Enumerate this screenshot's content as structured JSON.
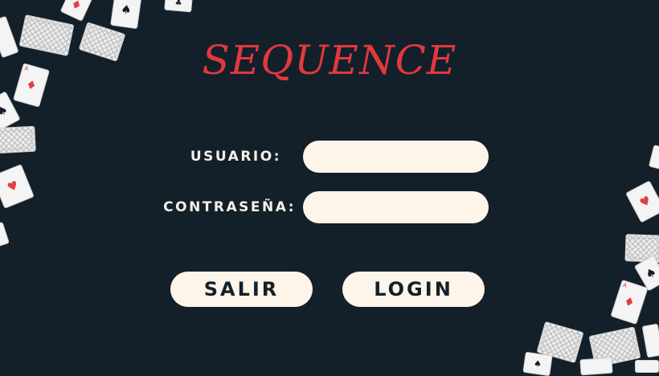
{
  "app": {
    "title": "SEQUENCE"
  },
  "form": {
    "user_label": "USUARIO:",
    "user_value": "",
    "password_label": "CONTRASEÑA:",
    "password_value": ""
  },
  "buttons": {
    "exit_label": "SALIR",
    "login_label": "LOGIN"
  },
  "colors": {
    "background": "#13202a",
    "title": "#e2383f",
    "field_bg": "#fdf5ea",
    "button_bg": "#fdf5ea",
    "text_light": "#f6f0e6"
  },
  "decor": {
    "card_suits": [
      "spade",
      "heart"
    ]
  }
}
